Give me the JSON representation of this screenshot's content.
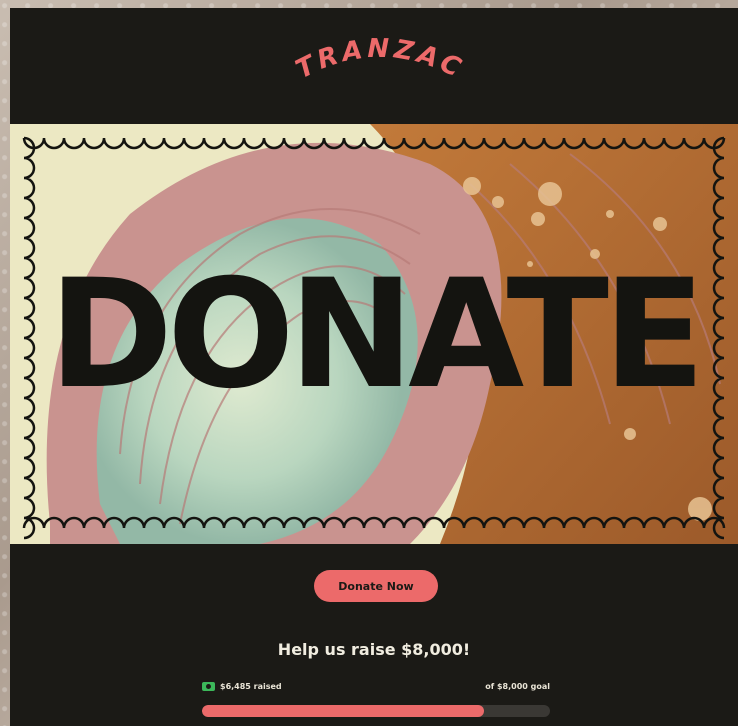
{
  "brand": {
    "logo_text": "TRANZAC",
    "accent": "#ec6a6a"
  },
  "banner": {
    "headline": "DONATE"
  },
  "cta": {
    "donate_label": "Donate Now"
  },
  "campaign": {
    "headline": "Help us raise $8,000!",
    "raised_text": "$6,485 raised",
    "goal_text": "of $8,000 goal",
    "raised": 6485,
    "goal": 8000
  }
}
